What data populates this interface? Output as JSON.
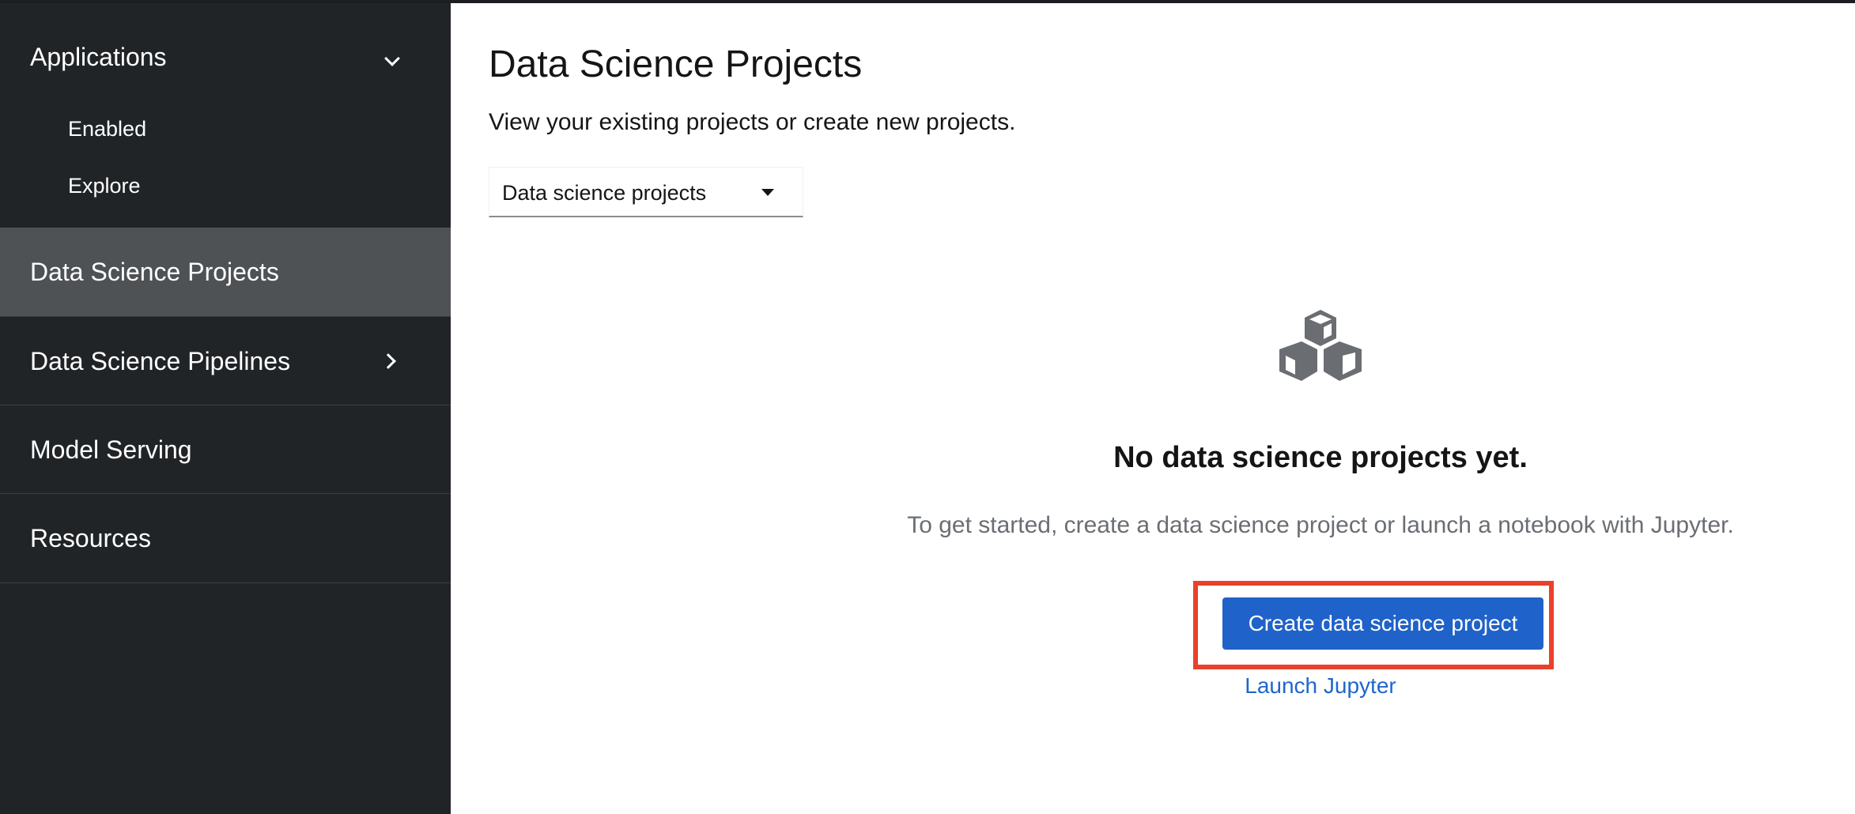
{
  "sidebar": {
    "applications": {
      "label": "Applications",
      "items": [
        {
          "label": "Enabled"
        },
        {
          "label": "Explore"
        }
      ]
    },
    "items": [
      {
        "label": "Data Science Projects",
        "active": true
      },
      {
        "label": "Data Science Pipelines",
        "has_children": true
      },
      {
        "label": "Model Serving"
      },
      {
        "label": "Resources"
      }
    ]
  },
  "main": {
    "title": "Data Science Projects",
    "description": "View your existing projects or create new projects.",
    "project_selector": {
      "value": "Data science projects"
    },
    "empty_state": {
      "icon": "cubes-icon",
      "title": "No data science projects yet.",
      "body": "To get started, create a data science project or launch a notebook with Jupyter.",
      "primary_action": "Create data science project",
      "secondary_action": "Launch Jupyter"
    }
  },
  "colors": {
    "sidebar_bg": "#212427",
    "sidebar_active": "#4f5255",
    "primary": "#1f62c9",
    "link": "#1f66cc",
    "highlight": "#e9412b"
  }
}
